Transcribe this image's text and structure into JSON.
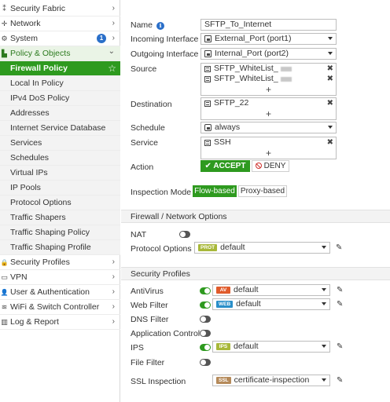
{
  "sidebar": {
    "items": [
      {
        "label": "Security Fabric",
        "icon": "security-fabric-icon",
        "glyph": "⁑",
        "chevron": "›"
      },
      {
        "label": "Network",
        "icon": "network-icon",
        "glyph": "✛",
        "chevron": "›"
      },
      {
        "label": "System",
        "icon": "gear-icon",
        "glyph": "⚙",
        "chevron": "›",
        "badge": "1"
      },
      {
        "label": "Policy & Objects",
        "icon": "policy-icon",
        "glyph": "▙",
        "chevron": "⌄"
      },
      {
        "label": "Firewall Policy",
        "sub": true,
        "active": true
      },
      {
        "label": "Local In Policy",
        "sub": true
      },
      {
        "label": "IPv4 DoS Policy",
        "sub": true
      },
      {
        "label": "Addresses",
        "sub": true
      },
      {
        "label": "Internet Service Database",
        "sub": true
      },
      {
        "label": "Services",
        "sub": true
      },
      {
        "label": "Schedules",
        "sub": true
      },
      {
        "label": "Virtual IPs",
        "sub": true
      },
      {
        "label": "IP Pools",
        "sub": true
      },
      {
        "label": "Protocol Options",
        "sub": true
      },
      {
        "label": "Traffic Shapers",
        "sub": true
      },
      {
        "label": "Traffic Shaping Policy",
        "sub": true
      },
      {
        "label": "Traffic Shaping Profile",
        "sub": true
      },
      {
        "label": "Security Profiles",
        "icon": "lock-icon",
        "glyph": "🔒",
        "chevron": "›"
      },
      {
        "label": "VPN",
        "icon": "monitor-icon",
        "glyph": "▭",
        "chevron": "›"
      },
      {
        "label": "User & Authentication",
        "icon": "user-icon",
        "glyph": "👤",
        "chevron": "›"
      },
      {
        "label": "WiFi & Switch Controller",
        "icon": "wifi-icon",
        "glyph": "≋",
        "chevron": "›"
      },
      {
        "label": "Log & Report",
        "icon": "chart-icon",
        "glyph": "▥",
        "chevron": "›"
      }
    ],
    "favorite_glyph": "☆"
  },
  "form": {
    "name_label": "Name",
    "name_value": "SFTP_To_Internet",
    "incoming_label": "Incoming Interface",
    "incoming_value": "External_Port (port1)",
    "outgoing_label": "Outgoing Interface",
    "outgoing_value": "Internal_Port (port2)",
    "source_label": "Source",
    "source_items": [
      "SFTP_WhiteList_",
      "SFTP_WhiteList_"
    ],
    "destination_label": "Destination",
    "destination_items": [
      "SFTP_22"
    ],
    "schedule_label": "Schedule",
    "schedule_value": "always",
    "service_label": "Service",
    "service_items": [
      "SSH"
    ],
    "action_label": "Action",
    "accept_label": "ACCEPT",
    "deny_label": "DENY",
    "inspection_label": "Inspection Mode",
    "flow_based": "Flow-based",
    "proxy_based": "Proxy-based",
    "plus_glyph": "+",
    "remove_glyph": "✖",
    "check_glyph": "✔"
  },
  "firewall_options": {
    "section_title": "Firewall / Network Options",
    "nat_label": "NAT",
    "nat_enabled": false,
    "protocol_options_label": "Protocol Options",
    "protocol_tag": "PROT",
    "protocol_value": "default"
  },
  "security_profiles": {
    "section_title": "Security Profiles",
    "antivirus_label": "AntiVirus",
    "antivirus_enabled": true,
    "antivirus_tag": "AV",
    "antivirus_value": "default",
    "webfilter_label": "Web Filter",
    "webfilter_enabled": true,
    "webfilter_tag": "WEB",
    "webfilter_value": "default",
    "dnsfilter_label": "DNS Filter",
    "dnsfilter_enabled": false,
    "appcontrol_label": "Application Control",
    "appcontrol_enabled": false,
    "ips_label": "IPS",
    "ips_enabled": true,
    "ips_tag": "IPS",
    "ips_value": "default",
    "filefilter_label": "File Filter",
    "filefilter_enabled": false,
    "ssl_label": "SSL Inspection",
    "ssl_tag": "SSL",
    "ssl_value": "certificate-inspection"
  },
  "colors": {
    "accent_green": "#2e9a1f",
    "info_blue": "#2a6fc9",
    "av_tag": "#e05b2b",
    "web_tag": "#2a8fc9",
    "ips_tag": "#a8b83a",
    "ssl_tag": "#b58a5a",
    "prot_tag": "#a8b83a",
    "deny_red": "#d0332e"
  }
}
